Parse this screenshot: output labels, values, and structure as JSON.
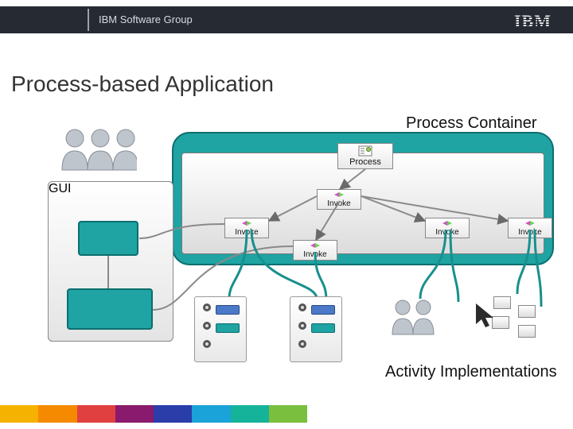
{
  "header": {
    "group": "IBM Software Group",
    "brand": "IBM"
  },
  "title": "Process-based Application",
  "container_label": "Process Container",
  "tags": {
    "process": "Process",
    "invoke": "Invoke"
  },
  "gui": {
    "label": "GUI"
  },
  "impl_label": "Activity Implementations"
}
